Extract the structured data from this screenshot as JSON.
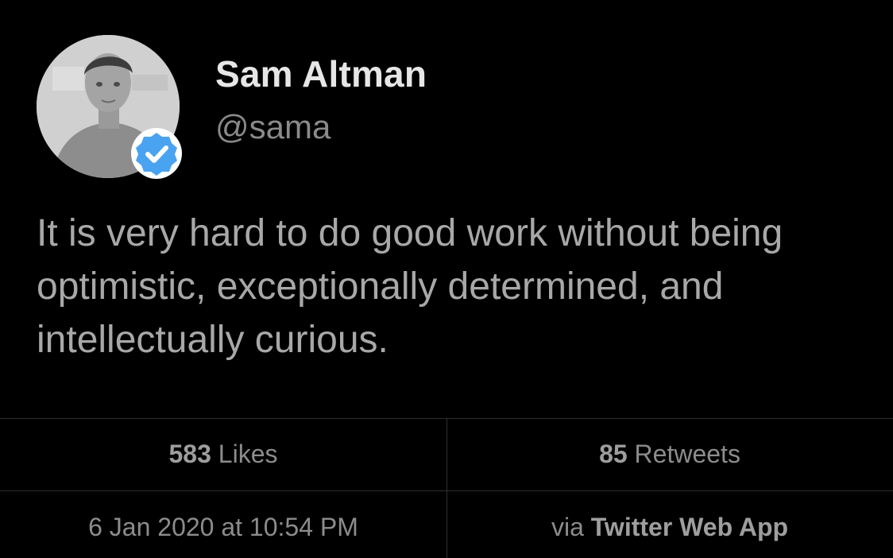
{
  "author": {
    "name": "Sam Altman",
    "handle": "@sama",
    "verified_badge_icon": "verified-check-icon",
    "badge_color": "#4aa3f0"
  },
  "tweet": {
    "text": "It is very hard to do good work without being optimistic, exceptionally determined, and intellectually curious."
  },
  "stats": {
    "likes_count": "583",
    "likes_label": "Likes",
    "retweets_count": "85",
    "retweets_label": "Retweets"
  },
  "meta": {
    "timestamp": "6 Jan 2020 at 10:54 PM",
    "via_prefix": "via",
    "source": "Twitter Web App"
  },
  "colors": {
    "background": "#000000",
    "name_text": "#e6e6e6",
    "body_text": "#a8a8a8",
    "secondary_text": "#8c8c8c",
    "divider": "#2f2f2f"
  }
}
